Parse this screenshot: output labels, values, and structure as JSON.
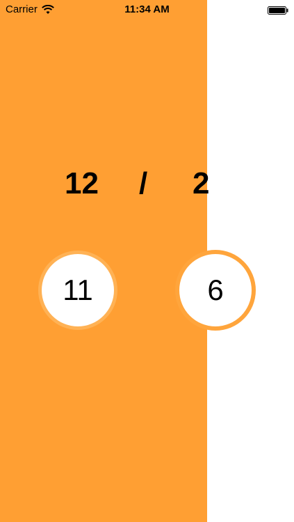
{
  "status_bar": {
    "carrier": "Carrier",
    "time": "11:34 AM",
    "icons": [
      "wifi-icon",
      "battery-icon"
    ]
  },
  "fraction": {
    "numerator": "12",
    "separator": "/",
    "denominator": "2"
  },
  "options": [
    {
      "label": "11"
    },
    {
      "label": "6"
    }
  ],
  "colors": {
    "panel": "#FF9F33",
    "background": "#FFFFFF",
    "circle_ring": "#FFA53C",
    "text": "#000000"
  }
}
